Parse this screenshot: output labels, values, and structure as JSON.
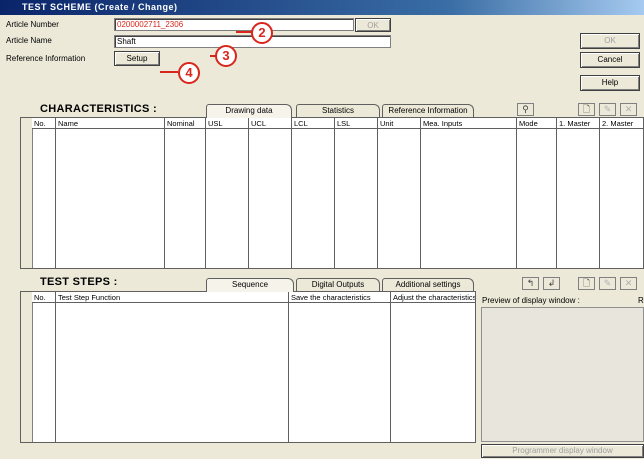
{
  "window": {
    "title": "TEST SCHEME   (Create / Change)"
  },
  "form": {
    "article_number_label": "Article Number",
    "article_number_value": "0200002711_2306",
    "article_name_label": "Article Name",
    "article_name_value": "Shaft",
    "reference_label": "Reference Information",
    "setup_button": "Setup",
    "ok_inline_button": "OK"
  },
  "side_buttons": {
    "ok": "OK",
    "cancel": "Cancel",
    "help": "Help"
  },
  "callouts": [
    "2",
    "3",
    "4"
  ],
  "characteristics": {
    "title": "CHARACTERISTICS :",
    "tabs": [
      "Drawing data",
      "Statistics",
      "Reference Information"
    ],
    "columns": [
      "No.",
      "Name",
      "Nominal",
      "USL",
      "UCL",
      "LCL",
      "LSL",
      "Unit",
      "Mea. Inputs",
      "Mode",
      "1. Master",
      "2. Master"
    ]
  },
  "test_steps": {
    "title": "TEST  STEPS :",
    "tabs": [
      "Sequence",
      "Digital Outputs",
      "Additional settings"
    ],
    "columns": [
      "No.",
      "Test Step Function",
      "Save the characteristics",
      "Adjust the characteristics"
    ],
    "preview_label": "Preview of display window :",
    "preview_right_label": "R",
    "programmer_button": "Programmer display window"
  },
  "colors": {
    "callout": "#d8261c",
    "article_number_text": "#d8261c",
    "titlebar": "#0a246a"
  }
}
